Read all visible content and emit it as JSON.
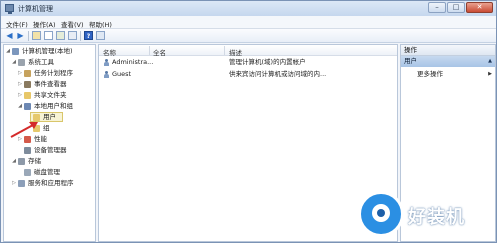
{
  "window": {
    "title": "计算机管理",
    "minimize": "–",
    "maximize": "□",
    "close": "✕"
  },
  "menubar": {
    "file": "文件(F)",
    "action": "操作(A)",
    "view": "查看(V)",
    "help": "帮助(H)"
  },
  "toolbar": {
    "back": "◀",
    "forward": "▶",
    "help": "?"
  },
  "tree": {
    "root": "计算机管理(本地)",
    "system_tools": "系统工具",
    "task_scheduler": "任务计划程序",
    "event_viewer": "事件查看器",
    "shared_folders": "共享文件夹",
    "local_users_groups": "本地用户和组",
    "users": "用户",
    "groups": "组",
    "performance": "性能",
    "device_manager": "设备管理器",
    "storage": "存储",
    "disk_management": "磁盘管理",
    "services_apps": "服务和应用程序"
  },
  "list": {
    "columns": {
      "name": "名称",
      "fullname": "全名",
      "description": "描述"
    },
    "rows": [
      {
        "name": "Administra...",
        "description": "管理计算机(域)的内置帐户"
      },
      {
        "name": "Guest",
        "description": "供来宾访问计算机或访问域的内..."
      }
    ]
  },
  "actions": {
    "header": "操作",
    "section": "用户",
    "more": "更多操作"
  },
  "watermark": {
    "text": "好装机"
  },
  "colors": {
    "accent": "#2b8fe3",
    "selection": "#f7f3d5",
    "arrow": "#d42a2a"
  }
}
